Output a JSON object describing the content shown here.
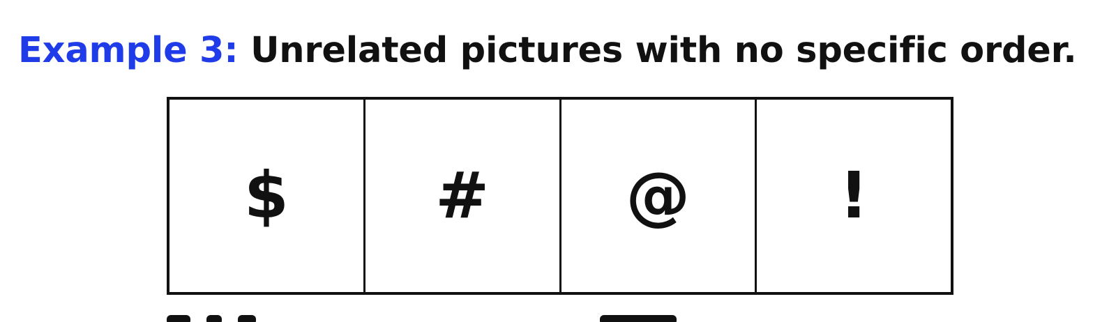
{
  "heading": {
    "lead": "Example 3:",
    "rest": "Unrelated pictures with no specific order."
  },
  "colors": {
    "lead": "#1f3ce8",
    "text": "#111111",
    "background": "#ffffff"
  },
  "panels": [
    {
      "symbol": "$"
    },
    {
      "symbol": "#"
    },
    {
      "symbol": "@"
    },
    {
      "symbol": "!"
    }
  ]
}
